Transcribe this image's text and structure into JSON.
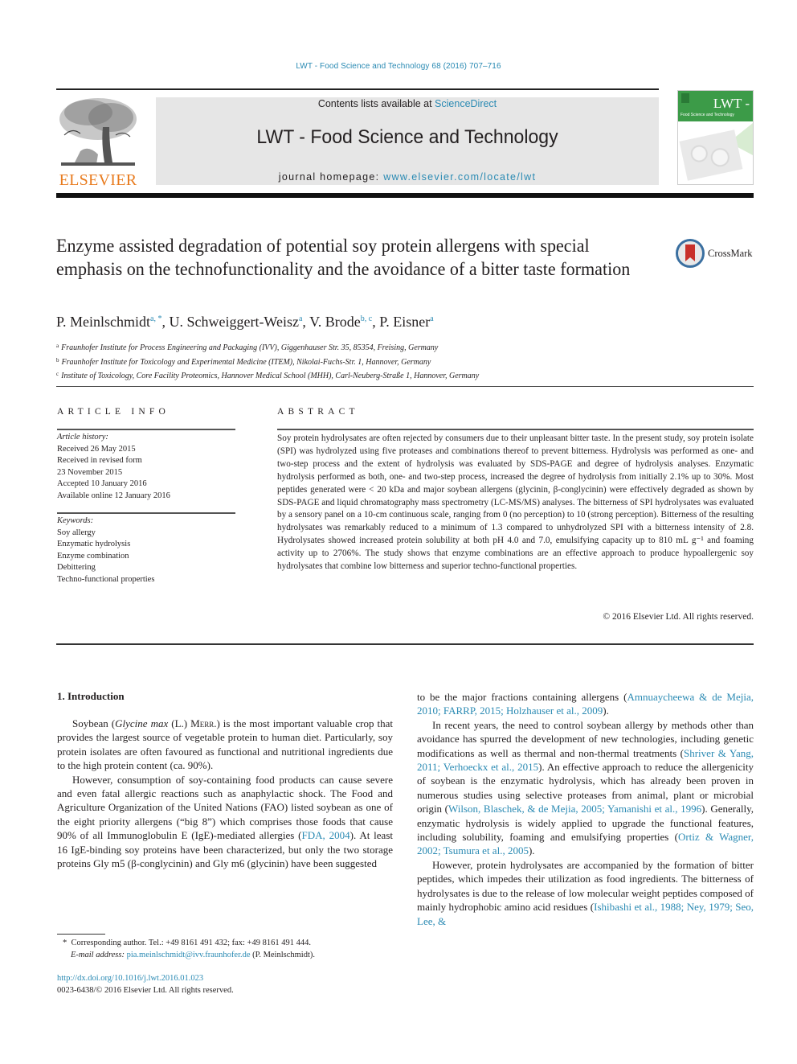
{
  "header": {
    "citation": "LWT - Food Science and Technology 68 (2016) 707–716",
    "contents_prefix": "Contents lists available at ",
    "contents_link": "ScienceDirect",
    "journal_title": "LWT - Food Science and Technology",
    "homepage_prefix": "journal homepage: ",
    "homepage_link": "www.elsevier.com/locate/lwt",
    "publisher_logo_text": "ELSEVIER",
    "cover_title": "LWT -",
    "cover_subtitle": "Food Science and Technology",
    "crossmark_label": "CrossMark"
  },
  "colors": {
    "link": "#2a8ab3",
    "elsevier_orange": "#e87b1e",
    "cover_green": "#3c9b48",
    "masthead_grey": "#e6e6e6"
  },
  "article": {
    "title": "Enzyme assisted degradation of potential soy protein allergens with special emphasis on the technofunctionality and the avoidance of a bitter taste formation",
    "authors": [
      {
        "name": "P. Meinlschmidt",
        "sup": "a, *"
      },
      {
        "name": "U. Schweiggert-Weisz",
        "sup": "a"
      },
      {
        "name": "V. Brode",
        "sup": "b, c"
      },
      {
        "name": "P. Eisner",
        "sup": "a"
      }
    ],
    "affiliations": [
      {
        "mark": "a",
        "text": "Fraunhofer Institute for Process Engineering and Packaging (IVV), Giggenhauser Str. 35, 85354, Freising, Germany"
      },
      {
        "mark": "b",
        "text": "Fraunhofer Institute for Toxicology and Experimental Medicine (ITEM), Nikolai-Fuchs-Str. 1, Hannover, Germany"
      },
      {
        "mark": "c",
        "text": "Institute of Toxicology, Core Facility Proteomics, Hannover Medical School (MHH), Carl-Neuberg-Straße 1, Hannover, Germany"
      }
    ]
  },
  "article_info": {
    "label": "ARTICLE INFO",
    "history_head": "Article history:",
    "history": [
      "Received 26 May 2015",
      "Received in revised form",
      "23 November 2015",
      "Accepted 10 January 2016",
      "Available online 12 January 2016"
    ],
    "keywords_head": "Keywords:",
    "keywords": [
      "Soy allergy",
      "Enzymatic hydrolysis",
      "Enzyme combination",
      "Debittering",
      "Techno-functional properties"
    ]
  },
  "abstract": {
    "label": "ABSTRACT",
    "text": "Soy protein hydrolysates are often rejected by consumers due to their unpleasant bitter taste. In the present study, soy protein isolate (SPI) was hydrolyzed using five proteases and combinations thereof to prevent bitterness. Hydrolysis was performed as one- and two-step process and the extent of hydrolysis was evaluated by SDS-PAGE and degree of hydrolysis analyses. Enzymatic hydrolysis performed as both, one- and two-step process, increased the degree of hydrolysis from initially 2.1% up to 30%. Most peptides generated were < 20 kDa and major soybean allergens (glycinin, β-conglycinin) were effectively degraded as shown by SDS-PAGE and liquid chromatography mass spectrometry (LC-MS/MS) analyses. The bitterness of SPI hydrolysates was evaluated by a sensory panel on a 10-cm continuous scale, ranging from 0 (no perception) to 10 (strong perception). Bitterness of the resulting hydrolysates was remarkably reduced to a minimum of 1.3 compared to unhydrolyzed SPI with a bitterness intensity of 2.8. Hydrolysates showed increased protein solubility at both pH 4.0 and 7.0, emulsifying capacity up to 810 mL g⁻¹ and foaming activity up to 2706%. The study shows that enzyme combinations are an effective approach to produce hypoallergenic soy hydrolysates that combine low bitterness and superior techno-functional properties.",
    "copyright": "© 2016 Elsevier Ltd. All rights reserved."
  },
  "body": {
    "section_heading": "1.  Introduction",
    "left": {
      "p1_a": "Soybean (",
      "p1_species": "Glycine max",
      "p1_b": " (L.) ",
      "p1_authority": "Merr.",
      "p1_c": ") is the most important valuable crop that provides the largest source of vegetable protein to human diet. Particularly, soy protein isolates are often favoured as functional and nutritional ingredients due to the high protein content (ca. 90%).",
      "p2_a": "However, consumption of soy-containing food products can cause severe and even fatal allergic reactions such as anaphylactic shock. The Food and Agriculture Organization of the United Nations (FAO) listed soybean as one of the eight priority allergens (“big 8”) which comprises those foods that cause 90% of all Immunoglobulin E (IgE)-mediated allergies (",
      "p2_ref": "FDA, 2004",
      "p2_b": "). At least 16 IgE-binding soy proteins have been characterized, but only the two storage proteins Gly m5 (β-conglycinin) and Gly m6 (glycinin) have been suggested"
    },
    "right": {
      "p0_a": "to be the major fractions containing allergens (",
      "p0_ref": "Amnuaycheewa & de Mejia, 2010; FARRP, 2015; Holzhauser et al., 2009",
      "p0_b": ").",
      "p1_a": "In recent years, the need to control soybean allergy by methods other than avoidance has spurred the development of new technologies, including genetic modifications as well as thermal and non-thermal treatments (",
      "p1_ref1": "Shriver & Yang, 2011; Verhoeckx et al., 2015",
      "p1_b": "). An effective approach to reduce the allergenicity of soybean is the enzymatic hydrolysis, which has already been proven in numerous studies using selective proteases from animal, plant or microbial origin (",
      "p1_ref2": "Wilson, Blaschek, & de Mejia, 2005; Yamanishi et al., 1996",
      "p1_c": "). Generally, enzymatic hydrolysis is widely applied to upgrade the functional features, including solubility, foaming and emulsifying properties (",
      "p1_ref3": "Ortiz & Wagner, 2002; Tsumura et al., 2005",
      "p1_d": ").",
      "p2_a": "However, protein hydrolysates are accompanied by the formation of bitter peptides, which impedes their utilization as food ingredients. The bitterness of hydrolysates is due to the release of low molecular weight peptides composed of mainly hydrophobic amino acid residues (",
      "p2_ref": "Ishibashi et al., 1988; Ney, 1979; Seo, Lee, &"
    }
  },
  "footnote": {
    "star": "*",
    "corresponding": "Corresponding author. Tel.: +49 8161 491 432; fax: +49 8161 491 444.",
    "email_label": "E-mail address:",
    "email": "pia.meinlschmidt@ivv.fraunhofer.de",
    "email_name": " (P. Meinlschmidt).",
    "doi": "http://dx.doi.org/10.1016/j.lwt.2016.01.023",
    "issn": "0023-6438/© 2016 Elsevier Ltd. All rights reserved."
  }
}
